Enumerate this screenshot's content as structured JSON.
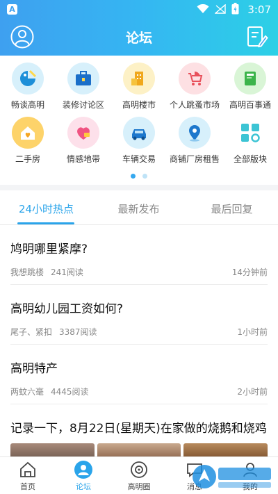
{
  "status_bar": {
    "time": "3:07",
    "app_badge": "A"
  },
  "header": {
    "title": "论坛"
  },
  "categories": [
    {
      "label": "畅谈高明",
      "icon": "fish-chat-icon"
    },
    {
      "label": "装修讨论区",
      "icon": "toolbox-icon"
    },
    {
      "label": "高明楼市",
      "icon": "building-icon"
    },
    {
      "label": "个人跳蚤市场",
      "icon": "stroller-icon"
    },
    {
      "label": "高明百事通",
      "icon": "book-icon"
    },
    {
      "label": "二手房",
      "icon": "house-heart-icon"
    },
    {
      "label": "情感地带",
      "icon": "heart-icon"
    },
    {
      "label": "车辆交易",
      "icon": "car-icon"
    },
    {
      "label": "商铺厂房租售",
      "icon": "location-pin-icon"
    },
    {
      "label": "全部版块",
      "icon": "grid-icon"
    }
  ],
  "pager": {
    "pages": 2,
    "active": 0
  },
  "tabs": [
    {
      "label": "24小时热点",
      "active": true
    },
    {
      "label": "最新发布",
      "active": false
    },
    {
      "label": "最后回复",
      "active": false
    }
  ],
  "posts": [
    {
      "title": "鸠明哪里紧摩?",
      "author": "我想跳楼",
      "reads": "241阅读",
      "time": "14分钟前"
    },
    {
      "title": "高明幼儿园工资如何?",
      "author": "尾子、紧扣",
      "reads": "3387阅读",
      "time": "1小时前"
    },
    {
      "title": "高明特产",
      "author": "两蚊六毫",
      "reads": "4445阅读",
      "time": "2小时前"
    },
    {
      "title": "记录一下，8月22日(星期天)在家做的烧鹅和烧鸡"
    }
  ],
  "bottom_nav": [
    {
      "label": "首页",
      "icon": "home-icon",
      "active": false
    },
    {
      "label": "论坛",
      "icon": "forum-icon",
      "active": true
    },
    {
      "label": "高明圈",
      "icon": "circle-icon",
      "active": false
    },
    {
      "label": "消息",
      "icon": "message-icon",
      "active": false
    },
    {
      "label": "我的",
      "icon": "profile-icon",
      "active": false
    }
  ],
  "colors": {
    "accent": "#2aa4ea",
    "header_start": "#3ea0f0",
    "header_end": "#2cd0e6"
  }
}
